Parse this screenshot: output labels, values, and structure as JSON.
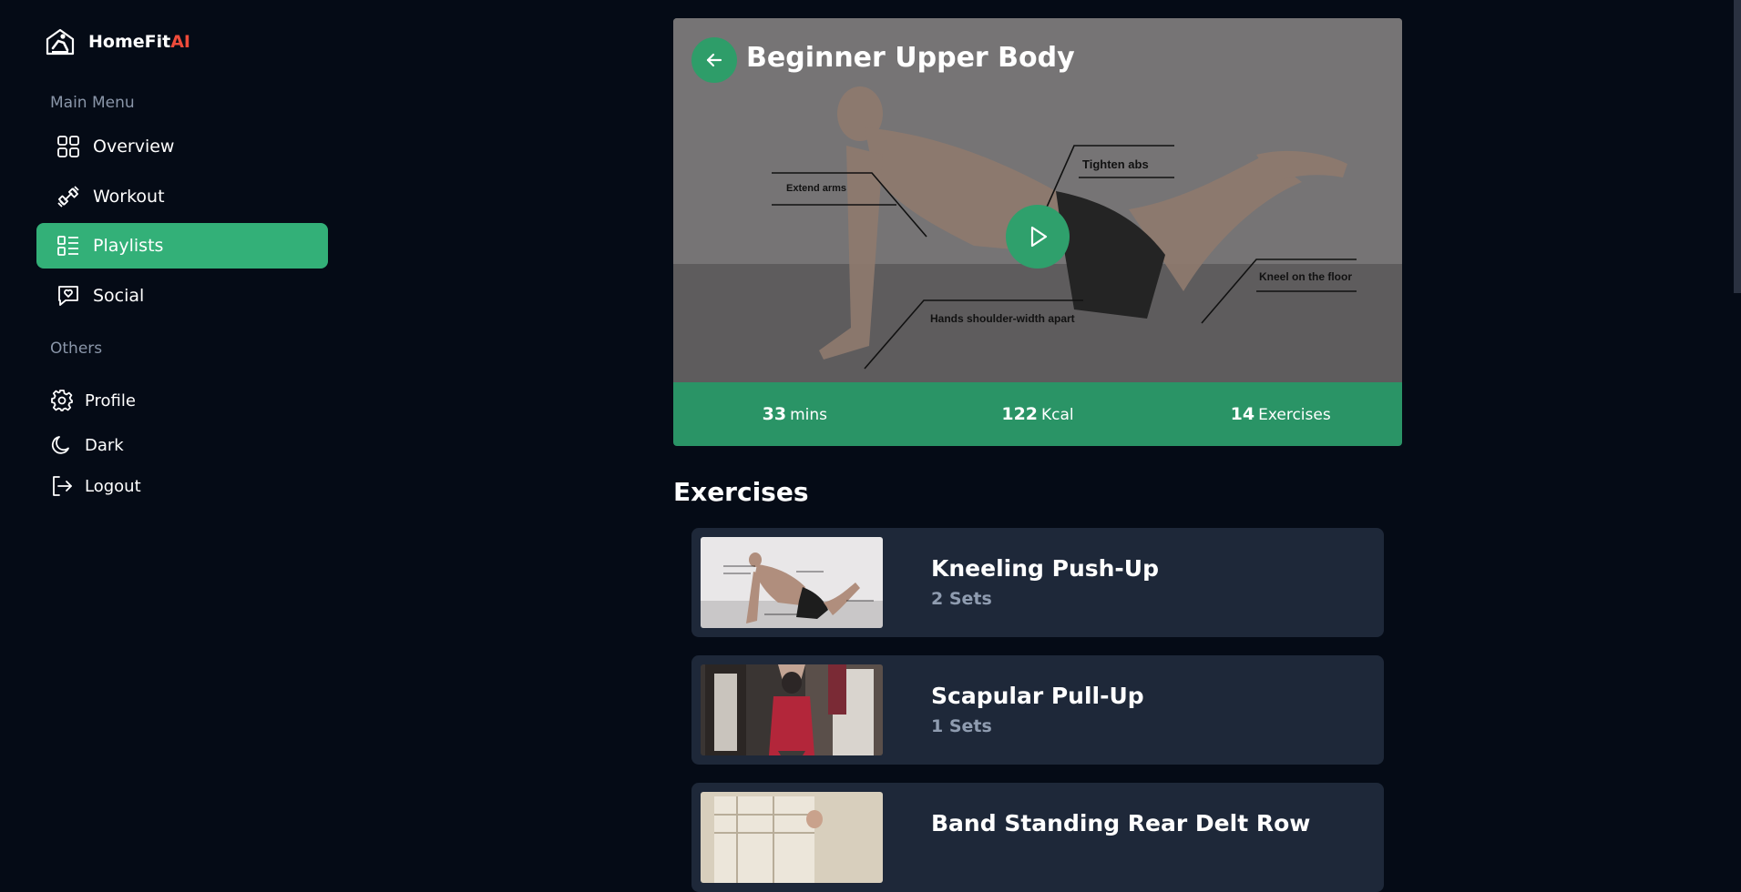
{
  "brand": {
    "name": "HomeFit",
    "suffix": "AI"
  },
  "sidebar": {
    "main_menu_label": "Main Menu",
    "items": [
      {
        "label": "Overview",
        "icon": "grid-icon",
        "active": false
      },
      {
        "label": "Workout",
        "icon": "dumbbell-icon",
        "active": false
      },
      {
        "label": "Playlists",
        "icon": "list-icon",
        "active": true
      },
      {
        "label": "Social",
        "icon": "chat-heart-icon",
        "active": false
      }
    ],
    "others_label": "Others",
    "others": [
      {
        "label": "Profile",
        "icon": "gear-icon"
      },
      {
        "label": "Dark",
        "icon": "moon-icon"
      },
      {
        "label": "Logout",
        "icon": "logout-icon"
      }
    ]
  },
  "hero": {
    "title": "Beginner Upper Body",
    "annotations": {
      "extend_arms": "Extend arms",
      "tighten_abs": "Tighten abs",
      "kneel": "Kneel on the floor",
      "hands": "Hands shoulder-width apart"
    },
    "stats": [
      {
        "value": "33",
        "unit": "mins"
      },
      {
        "value": "122",
        "unit": "Kcal"
      },
      {
        "value": "14",
        "unit": "Exercises"
      }
    ]
  },
  "exercises_heading": "Exercises",
  "exercises": [
    {
      "name": "Kneeling Push-Up",
      "sets": "2 Sets"
    },
    {
      "name": "Scapular Pull-Up",
      "sets": "1 Sets"
    },
    {
      "name": "Band Standing Rear Delt Row",
      "sets": ""
    }
  ],
  "colors": {
    "accent": "#33b078",
    "accent_dark": "#2a9466",
    "card": "#1e2839",
    "bg": "#050b16",
    "brand_ai": "#ef4b3a"
  }
}
